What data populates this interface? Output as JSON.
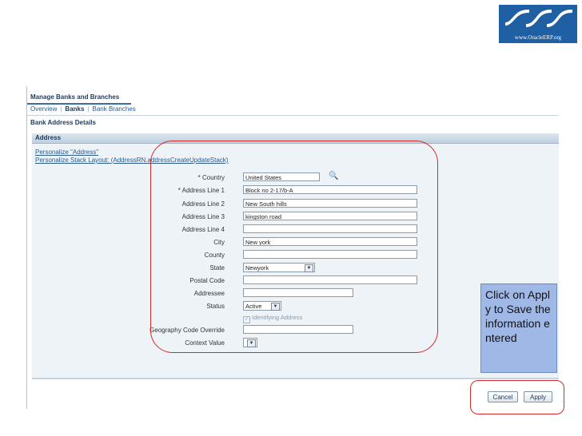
{
  "logo": {
    "caption": "www.OracleERP.org"
  },
  "app": {
    "title": "Manage Banks and Branches",
    "tabs": [
      "Overview",
      "Banks",
      "Bank Branches"
    ],
    "active_tab": "Banks",
    "page_title": "Bank Address Details"
  },
  "region": {
    "header": "Address",
    "personalize_link": "Personalize \"Address\"",
    "personalize_stack_link": "Personalize Stack Layout: (AddressRN.addressCreateUpdateStack)"
  },
  "form": {
    "country": {
      "label": "* Country",
      "value": "United States"
    },
    "address1": {
      "label": "* Address Line 1",
      "value": "Block no 2-17/b-A"
    },
    "address2": {
      "label": "Address Line 2",
      "value": "New South hills"
    },
    "address3": {
      "label": "Address Line 3",
      "value": "kingston road"
    },
    "address4": {
      "label": "Address Line 4",
      "value": ""
    },
    "city": {
      "label": "City",
      "value": "New york"
    },
    "county": {
      "label": "County",
      "value": ""
    },
    "state": {
      "label": "State",
      "value": "Newyork"
    },
    "postal": {
      "label": "Postal Code",
      "value": ""
    },
    "addressee": {
      "label": "Addressee",
      "value": ""
    },
    "status": {
      "label": "Status",
      "value": "Active"
    },
    "identifying": {
      "label": "Identifying Address",
      "checked": true
    },
    "geo_override": {
      "label": "Geography Code Override",
      "value": ""
    },
    "context": {
      "label": "Context Value",
      "value": ""
    }
  },
  "buttons": {
    "cancel": "Cancel",
    "apply": "Apply"
  },
  "callout": {
    "text": "Click on Apply to Save the information entered"
  },
  "colors": {
    "annotation_red": "#d42a2a",
    "callout_blue": "#9fb8e6",
    "logo_blue": "#1f5fa3",
    "header_blue": "#1f3a5c"
  }
}
